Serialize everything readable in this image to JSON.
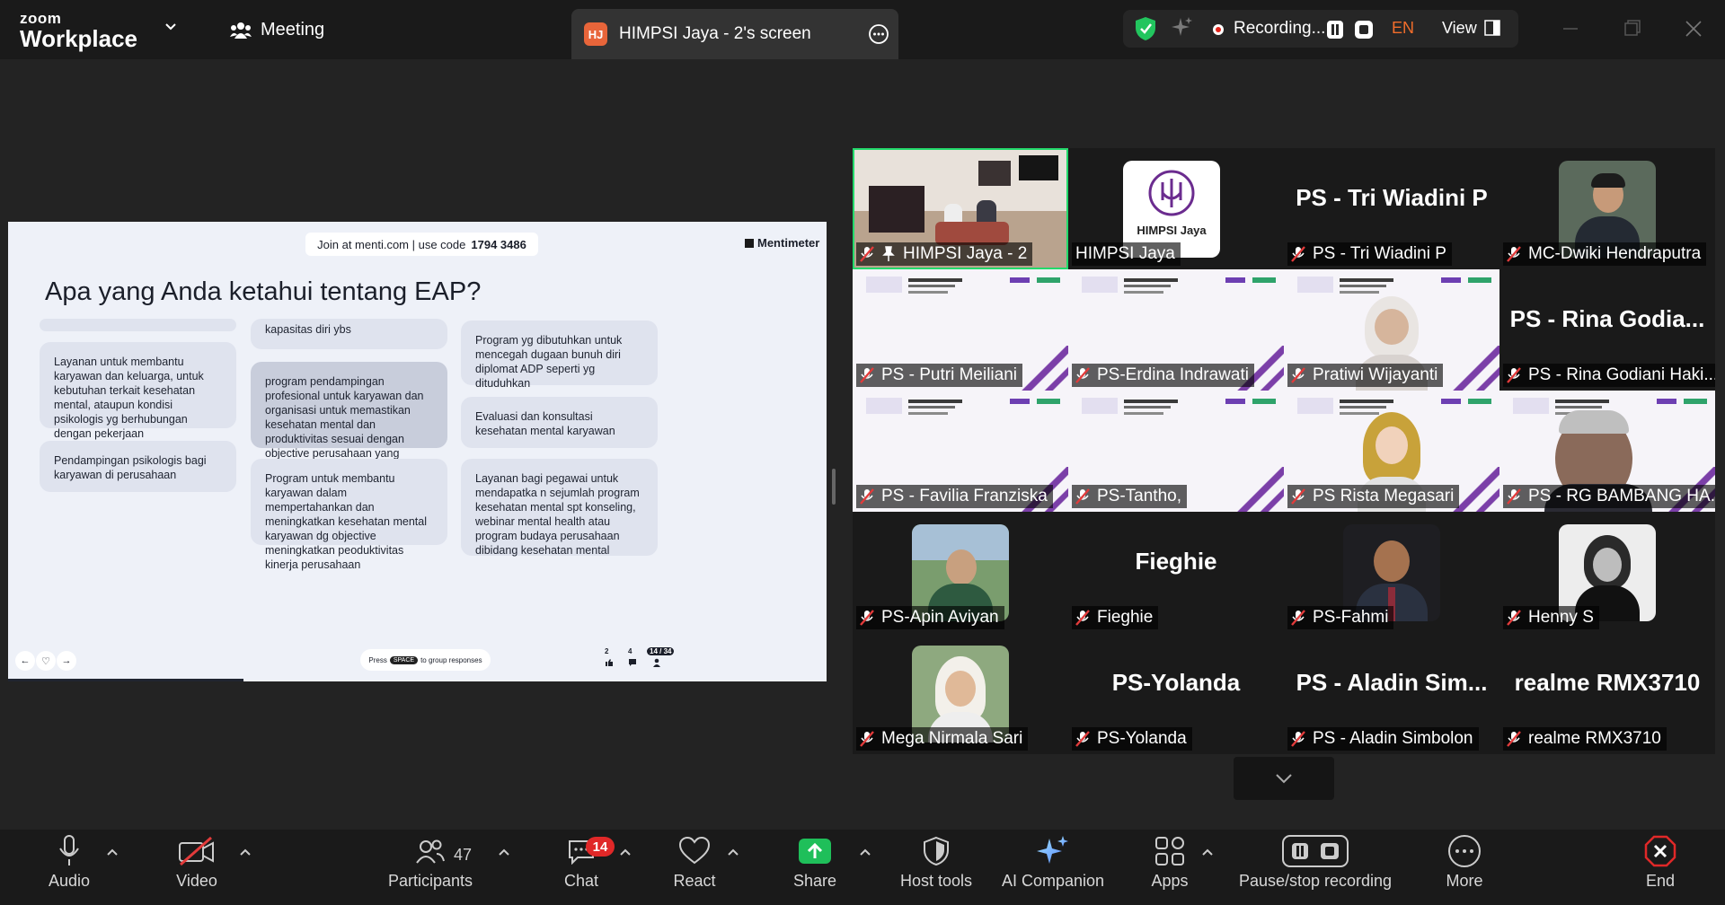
{
  "app": {
    "logo_top": "zoom",
    "logo_bottom": "Workplace"
  },
  "header": {
    "meeting_label": "Meeting",
    "screen_tab": {
      "initials": "HJ",
      "title": "HIMPSI Jaya - 2's screen"
    },
    "recording_label": "Recording...",
    "language": "EN",
    "view_label": "View"
  },
  "shared_screen": {
    "join": {
      "text": "Join at menti.com | use code",
      "code": "1794 3486"
    },
    "brand": "Mentimeter",
    "question": "Apa yang Anda ketahui tentang EAP?",
    "responses": [
      {
        "text": ""
      },
      {
        "text": "kapasitas diri ybs"
      },
      {
        "text": "Program yg dibutuhkan untuk mencegah dugaan bunuh diri diplomat ADP seperti yg dituduhkan"
      },
      {
        "text": "Layanan untuk membantu karyawan dan keluarga, untuk kebutuhan terkait kesehatan mental, ataupun kondisi psikologis yg berhubungan dengan pekerjaan"
      },
      {
        "text": "program pendampingan profesional untuk karyawan dan organisasi untuk memastikan kesehatan mental dan produktivitas sesuai dengan objective perusahaan yang berjalan"
      },
      {
        "text": "Evaluasi dan konsultasi kesehatan mental karyawan"
      },
      {
        "text": "Pendampingan psikologis bagi karyawan di perusahaan"
      },
      {
        "text": "Program untuk membantu karyawan dalam mempertahankan dan meningkatkan kesehatan mental karyawan dg objective meningkatkan peoduktivitas kinerja perusahaan"
      },
      {
        "text": "Layanan bagi pegawai untuk mendapatka n sejumlah program kesehatan mental spt konseling, webinar mental health atau program budaya perusahaan dibidang kesehatan mental"
      }
    ],
    "press_hint": {
      "pre": "Press",
      "key": "SPACE",
      "post": "to group responses"
    },
    "reactions_count": "2",
    "comments_count": "4",
    "participants_ratio": "14 / 34"
  },
  "gallery": [
    {
      "name": "HIMPSI Jaya - 2",
      "big": "",
      "kind": "video-room",
      "active": true,
      "pinned": true
    },
    {
      "name": "HIMPSI Jaya",
      "big": "",
      "kind": "logo",
      "logo_text": "HIMPSI Jaya"
    },
    {
      "name": "PS - Tri Wiadini P",
      "big": "PS - Tri Wiadini P",
      "kind": "name"
    },
    {
      "name": "MC-Dwiki Hendraputra",
      "big": "",
      "kind": "avatar"
    },
    {
      "name": "PS - Putri Meiliani",
      "big": "",
      "kind": "slide"
    },
    {
      "name": "PS-Erdina Indrawati",
      "big": "",
      "kind": "slide"
    },
    {
      "name": "Pratiwi Wijayanti",
      "big": "",
      "kind": "slide-person"
    },
    {
      "name": "PS - Rina Godiani Haki...",
      "big": "PS - Rina Godia...",
      "kind": "name"
    },
    {
      "name": "PS - Favilia Franziska",
      "big": "",
      "kind": "slide"
    },
    {
      "name": "PS-Tantho,",
      "big": "",
      "kind": "slide"
    },
    {
      "name": "PS Rista Megasari",
      "big": "",
      "kind": "slide-avatar"
    },
    {
      "name": "PS - RG BAMBANG HA...",
      "big": "",
      "kind": "slide-person"
    },
    {
      "name": "PS-Apin Aviyan",
      "big": "",
      "kind": "avatar"
    },
    {
      "name": "Fieghie",
      "big": "Fieghie",
      "kind": "name"
    },
    {
      "name": "PS-Fahmi",
      "big": "",
      "kind": "avatar"
    },
    {
      "name": "Henny S",
      "big": "",
      "kind": "avatar"
    },
    {
      "name": "Mega Nirmala Sari",
      "big": "",
      "kind": "avatar"
    },
    {
      "name": "PS-Yolanda",
      "big": "PS-Yolanda",
      "kind": "name"
    },
    {
      "name": "PS - Aladin Simbolon",
      "big": "PS - Aladin Sim...",
      "kind": "name"
    },
    {
      "name": "realme RMX3710",
      "big": "realme RMX3710",
      "kind": "name"
    }
  ],
  "toolbar": {
    "audio": "Audio",
    "video": "Video",
    "participants": "Participants",
    "participants_count": "47",
    "chat": "Chat",
    "chat_badge": "14",
    "react": "React",
    "share": "Share",
    "host_tools": "Host tools",
    "ai_companion": "AI Companion",
    "apps": "Apps",
    "pause_recording": "Pause/stop recording",
    "more": "More",
    "end": "End"
  },
  "colors": {
    "accent_green": "#23d96b",
    "record_red": "#e2231a",
    "share_green": "#1fbf5a",
    "end_red": "#e02828"
  }
}
